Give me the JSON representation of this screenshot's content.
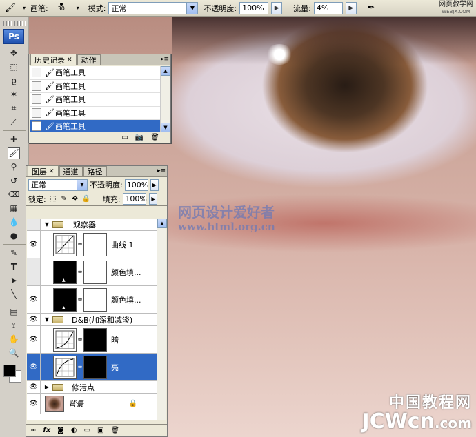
{
  "options_bar": {
    "brush_label": "画笔:",
    "brush_size": "30",
    "mode_label": "模式:",
    "mode_value": "正常",
    "opacity_label": "不透明度:",
    "opacity_value": "100%",
    "flow_label": "流量:",
    "flow_value": "4%"
  },
  "site_watermark": {
    "name": "网页教学网",
    "url": "WEBJX.COM"
  },
  "toolbox": {
    "logo": "Ps"
  },
  "canvas": {
    "watermark_title": "网页设计爱好者",
    "watermark_url": "www.html.org.cn",
    "corner_cn": "中国教程网",
    "corner_en": "JCWcn",
    "corner_en_suffix": ".com"
  },
  "history_panel": {
    "tabs": [
      "历史记录",
      "动作"
    ],
    "items": [
      "画笔工具",
      "画笔工具",
      "画笔工具",
      "画笔工具",
      "画笔工具"
    ],
    "selected_index": 4
  },
  "layers_panel": {
    "tabs": [
      "图层",
      "通道",
      "路径"
    ],
    "blend_mode": "正常",
    "opacity_label": "不透明度:",
    "opacity_value": "100%",
    "lock_label": "锁定:",
    "fill_label": "填充:",
    "fill_value": "100%",
    "layers": [
      {
        "kind": "group",
        "name": "观察器",
        "visible": false,
        "expanded": true
      },
      {
        "kind": "curves",
        "name": "曲线 1",
        "visible": true,
        "mask": "white"
      },
      {
        "kind": "fill",
        "name": "颜色填...",
        "visible": false,
        "mask": "white"
      },
      {
        "kind": "fill",
        "name": "颜色填...",
        "visible": true,
        "mask": "white"
      },
      {
        "kind": "group",
        "name": "D&B(加深和减淡)",
        "visible": true,
        "expanded": true
      },
      {
        "kind": "curves",
        "name": "暗",
        "visible": true,
        "mask": "black"
      },
      {
        "kind": "curves",
        "name": "亮",
        "visible": true,
        "mask": "black",
        "selected": true
      },
      {
        "kind": "group",
        "name": "修污点",
        "visible": true,
        "expanded": false
      },
      {
        "kind": "background",
        "name": "背景",
        "visible": true,
        "locked": true
      }
    ]
  },
  "colors": {
    "selection": "#316ac5",
    "panel_bg": "#ece9d8",
    "foreground": "#000000",
    "background": "#ffffff"
  }
}
